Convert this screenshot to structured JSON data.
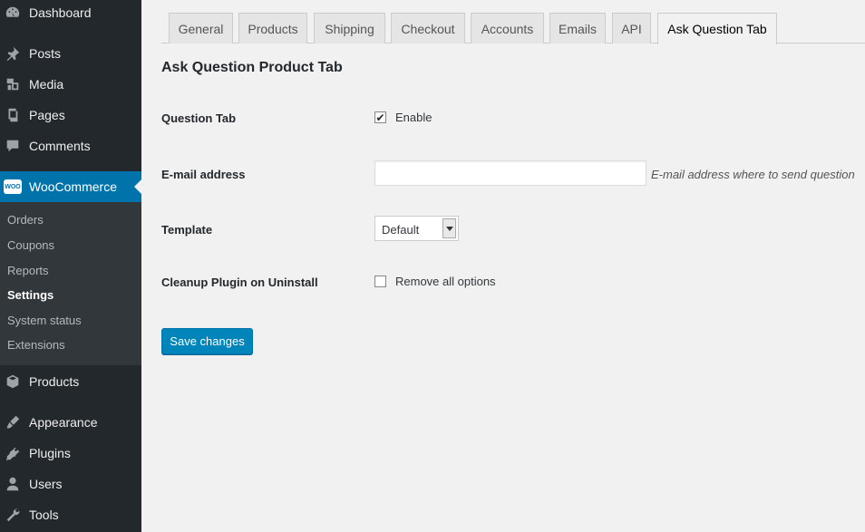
{
  "sidebar": {
    "items": [
      {
        "label": "Dashboard",
        "icon": "dashboard-icon"
      },
      {
        "label": "Posts",
        "icon": "pin-icon"
      },
      {
        "label": "Media",
        "icon": "media-icon"
      },
      {
        "label": "Pages",
        "icon": "pages-icon"
      },
      {
        "label": "Comments",
        "icon": "comments-icon"
      },
      {
        "label": "WooCommerce",
        "icon": "woocommerce-icon",
        "badge": "WOO"
      },
      {
        "label": "Products",
        "icon": "products-icon"
      },
      {
        "label": "Appearance",
        "icon": "brush-icon"
      },
      {
        "label": "Plugins",
        "icon": "plugin-icon"
      },
      {
        "label": "Users",
        "icon": "user-icon"
      },
      {
        "label": "Tools",
        "icon": "wrench-icon"
      }
    ],
    "submenu": [
      {
        "label": "Orders"
      },
      {
        "label": "Coupons"
      },
      {
        "label": "Reports"
      },
      {
        "label": "Settings"
      },
      {
        "label": "System status"
      },
      {
        "label": "Extensions"
      }
    ]
  },
  "tabs": [
    {
      "label": "General"
    },
    {
      "label": "Products"
    },
    {
      "label": "Shipping"
    },
    {
      "label": "Checkout"
    },
    {
      "label": "Accounts"
    },
    {
      "label": "Emails"
    },
    {
      "label": "API"
    },
    {
      "label": "Ask Question Tab"
    }
  ],
  "page": {
    "title": "Ask Question Product Tab",
    "question_tab": {
      "label": "Question Tab",
      "checkbox_label": "Enable",
      "checked": true
    },
    "email": {
      "label": "E-mail address",
      "value": "",
      "description": "E-mail address where to send question"
    },
    "template": {
      "label": "Template",
      "selected": "Default"
    },
    "cleanup": {
      "label": "Cleanup Plugin on Uninstall",
      "checkbox_label": "Remove all options",
      "checked": false
    },
    "save_label": "Save changes"
  },
  "colors": {
    "sidebar_bg": "#23282d",
    "submenu_bg": "#32373c",
    "accent": "#0073aa",
    "button": "#0085ba",
    "page_bg": "#f1f1f1"
  }
}
